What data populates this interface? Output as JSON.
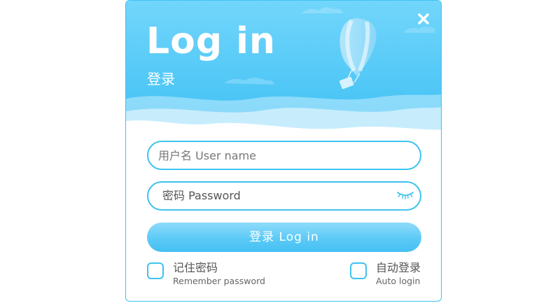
{
  "dialog": {
    "title": "Log in",
    "subtitle": "登录",
    "close_icon": "close-icon"
  },
  "form": {
    "username_placeholder": "用户名 User name",
    "password_label": "密码 Password",
    "password_icon": "closed-eye-icon",
    "login_button_label": "登录 Log in"
  },
  "options": {
    "remember": {
      "label_cn": "记住密码",
      "label_en": "Remember password"
    },
    "auto_login": {
      "label_cn": "自动登录",
      "label_en": "Auto login"
    }
  },
  "colors": {
    "accent": "#3fc3ef",
    "header_sky": "#49c4f7",
    "button": "#5ccaf6"
  }
}
